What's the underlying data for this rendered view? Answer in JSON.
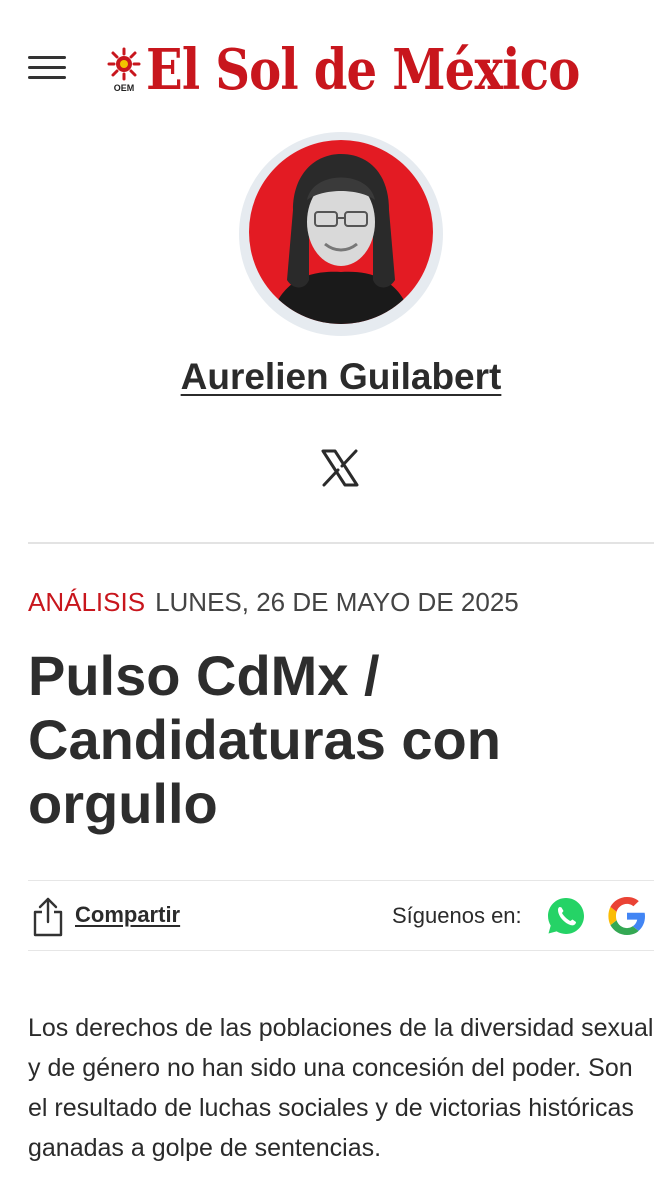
{
  "header": {
    "logo_text": "El Sol de México",
    "logo_emblem_text": "OEM",
    "menu_icon": "hamburger-menu-icon"
  },
  "author": {
    "name": "Aurelien Guilabert",
    "social_icon": "x-twitter-icon"
  },
  "article": {
    "section": "ANÁLISIS",
    "date": "LUNES, 26 DE MAYO DE 2025",
    "title": "Pulso CdMx / Candidaturas con orgullo",
    "share_label": "Compartir",
    "follow_label": "Síguenos en:",
    "body": "Los derechos de las poblaciones de la diversidad sexual y de género no han sido una concesión del poder. Son el resultado de luchas sociales y de victorias históricas ganadas a golpe de sentencias."
  },
  "colors": {
    "brand_red": "#c8161d",
    "avatar_bg": "#e31b23",
    "whatsapp_green": "#25d366"
  }
}
